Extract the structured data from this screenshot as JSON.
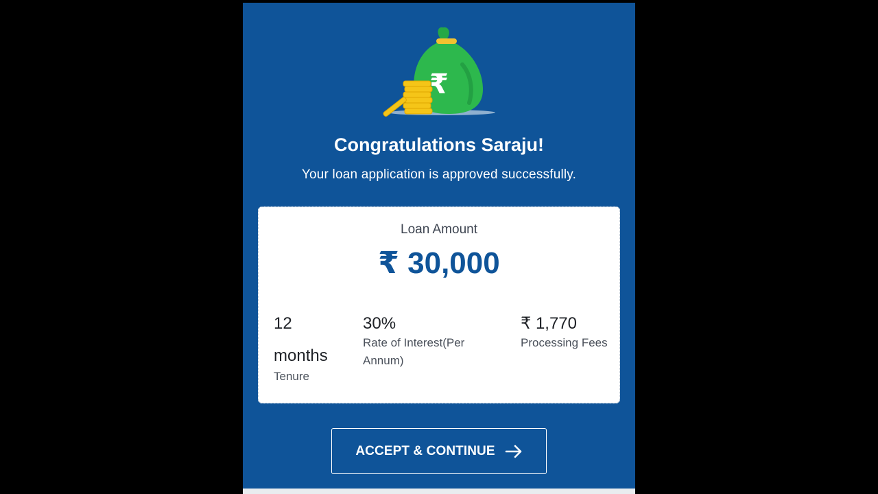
{
  "header": {
    "title": "Congratulations Saraju!",
    "subtitle": "Your loan application is approved successfully."
  },
  "loan": {
    "label": "Loan Amount",
    "amount": "₹ 30,000"
  },
  "details": [
    {
      "value": "12 months",
      "label": "Tenure"
    },
    {
      "value": "30%",
      "label": "Rate of Interest(Per Annum)"
    },
    {
      "value": "₹ 1,770",
      "label": "Processing Fees"
    }
  ],
  "cta": {
    "label": "ACCEPT & CONTINUE",
    "icon": "arrow-right-icon"
  },
  "illustration": {
    "icon": "money-bag-icon",
    "symbol": "₹"
  },
  "colors": {
    "brand": "#0f5499",
    "card": "#ffffff",
    "bag": "#2db84d",
    "coins": "#f5c518"
  }
}
